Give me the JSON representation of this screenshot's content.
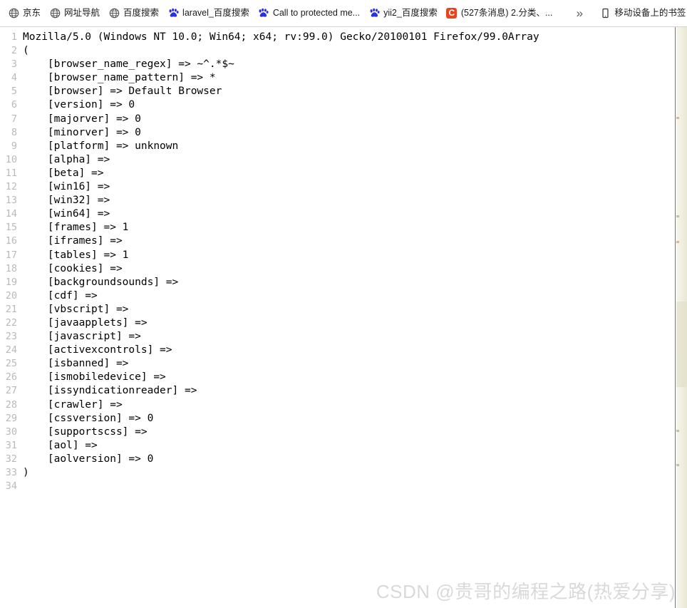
{
  "bookmarks_bar": {
    "items": [
      {
        "icon": "globe-icon",
        "label": "京东"
      },
      {
        "icon": "globe-icon",
        "label": "网址导航"
      },
      {
        "icon": "globe-icon",
        "label": "百度搜索"
      },
      {
        "icon": "baidu-paw-icon",
        "label": "laravel_百度搜索"
      },
      {
        "icon": "baidu-paw-icon",
        "label": "Call to protected me..."
      },
      {
        "icon": "baidu-paw-icon",
        "label": "yii2_百度搜索"
      },
      {
        "icon": "csdn-icon",
        "label": "(527条消息) 2.分类、..."
      }
    ],
    "overflow_label": "»",
    "mobile_bookmarks": {
      "icon": "mobile-device-icon",
      "label": "移动设备上的书签"
    }
  },
  "code": {
    "lines": [
      {
        "n": "1",
        "text": "Mozilla/5.0 (Windows NT 10.0; Win64; x64; rv:99.0) Gecko/20100101 Firefox/99.0Array"
      },
      {
        "n": "2",
        "text": "("
      },
      {
        "n": "3",
        "text": "    [browser_name_regex] => ~^.*$~"
      },
      {
        "n": "4",
        "text": "    [browser_name_pattern] => *"
      },
      {
        "n": "5",
        "text": "    [browser] => Default Browser"
      },
      {
        "n": "6",
        "text": "    [version] => 0"
      },
      {
        "n": "7",
        "text": "    [majorver] => 0"
      },
      {
        "n": "8",
        "text": "    [minorver] => 0"
      },
      {
        "n": "9",
        "text": "    [platform] => unknown"
      },
      {
        "n": "10",
        "text": "    [alpha] =>"
      },
      {
        "n": "11",
        "text": "    [beta] =>"
      },
      {
        "n": "12",
        "text": "    [win16] =>"
      },
      {
        "n": "13",
        "text": "    [win32] =>"
      },
      {
        "n": "14",
        "text": "    [win64] =>"
      },
      {
        "n": "15",
        "text": "    [frames] => 1"
      },
      {
        "n": "16",
        "text": "    [iframes] =>"
      },
      {
        "n": "17",
        "text": "    [tables] => 1"
      },
      {
        "n": "18",
        "text": "    [cookies] =>"
      },
      {
        "n": "19",
        "text": "    [backgroundsounds] =>"
      },
      {
        "n": "20",
        "text": "    [cdf] =>"
      },
      {
        "n": "21",
        "text": "    [vbscript] =>"
      },
      {
        "n": "22",
        "text": "    [javaapplets] =>"
      },
      {
        "n": "23",
        "text": "    [javascript] =>"
      },
      {
        "n": "24",
        "text": "    [activexcontrols] =>"
      },
      {
        "n": "25",
        "text": "    [isbanned] =>"
      },
      {
        "n": "26",
        "text": "    [ismobiledevice] =>"
      },
      {
        "n": "27",
        "text": "    [issyndicationreader] =>"
      },
      {
        "n": "28",
        "text": "    [crawler] =>"
      },
      {
        "n": "29",
        "text": "    [cssversion] => 0"
      },
      {
        "n": "30",
        "text": "    [supportscss] =>"
      },
      {
        "n": "31",
        "text": "    [aol] =>"
      },
      {
        "n": "32",
        "text": "    [aolversion] => 0"
      },
      {
        "n": "33",
        "text": ")"
      },
      {
        "n": "34",
        "text": ""
      }
    ]
  },
  "watermark": {
    "text": "CSDN @贵哥的编程之路(热爱分享)"
  },
  "colors": {
    "csdn_badge": "#e8441f",
    "baidu_blue": "#2932e1",
    "line_number": "#b9b9b9",
    "watermark": "#d9d9d9"
  }
}
